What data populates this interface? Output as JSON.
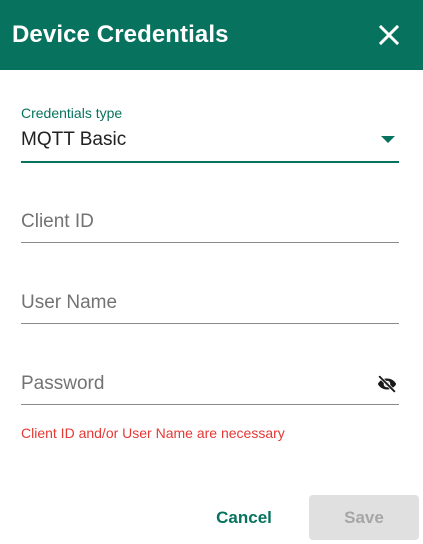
{
  "dialog": {
    "title": "Device Credentials",
    "header_color": "#07735f"
  },
  "credentials_type": {
    "label": "Credentials type",
    "selected": "MQTT Basic"
  },
  "fields": {
    "client_id": {
      "placeholder": "Client ID",
      "value": ""
    },
    "user_name": {
      "placeholder": "User Name",
      "value": ""
    },
    "password": {
      "placeholder": "Password",
      "value": ""
    }
  },
  "error": {
    "message": "Client ID and/or User Name are necessary",
    "color": "#e53935"
  },
  "actions": {
    "cancel_label": "Cancel",
    "save_label": "Save",
    "save_enabled": false
  },
  "icons": {
    "close": "close-icon",
    "dropdown": "dropdown-arrow-icon",
    "password_toggle": "eye-off-icon"
  }
}
